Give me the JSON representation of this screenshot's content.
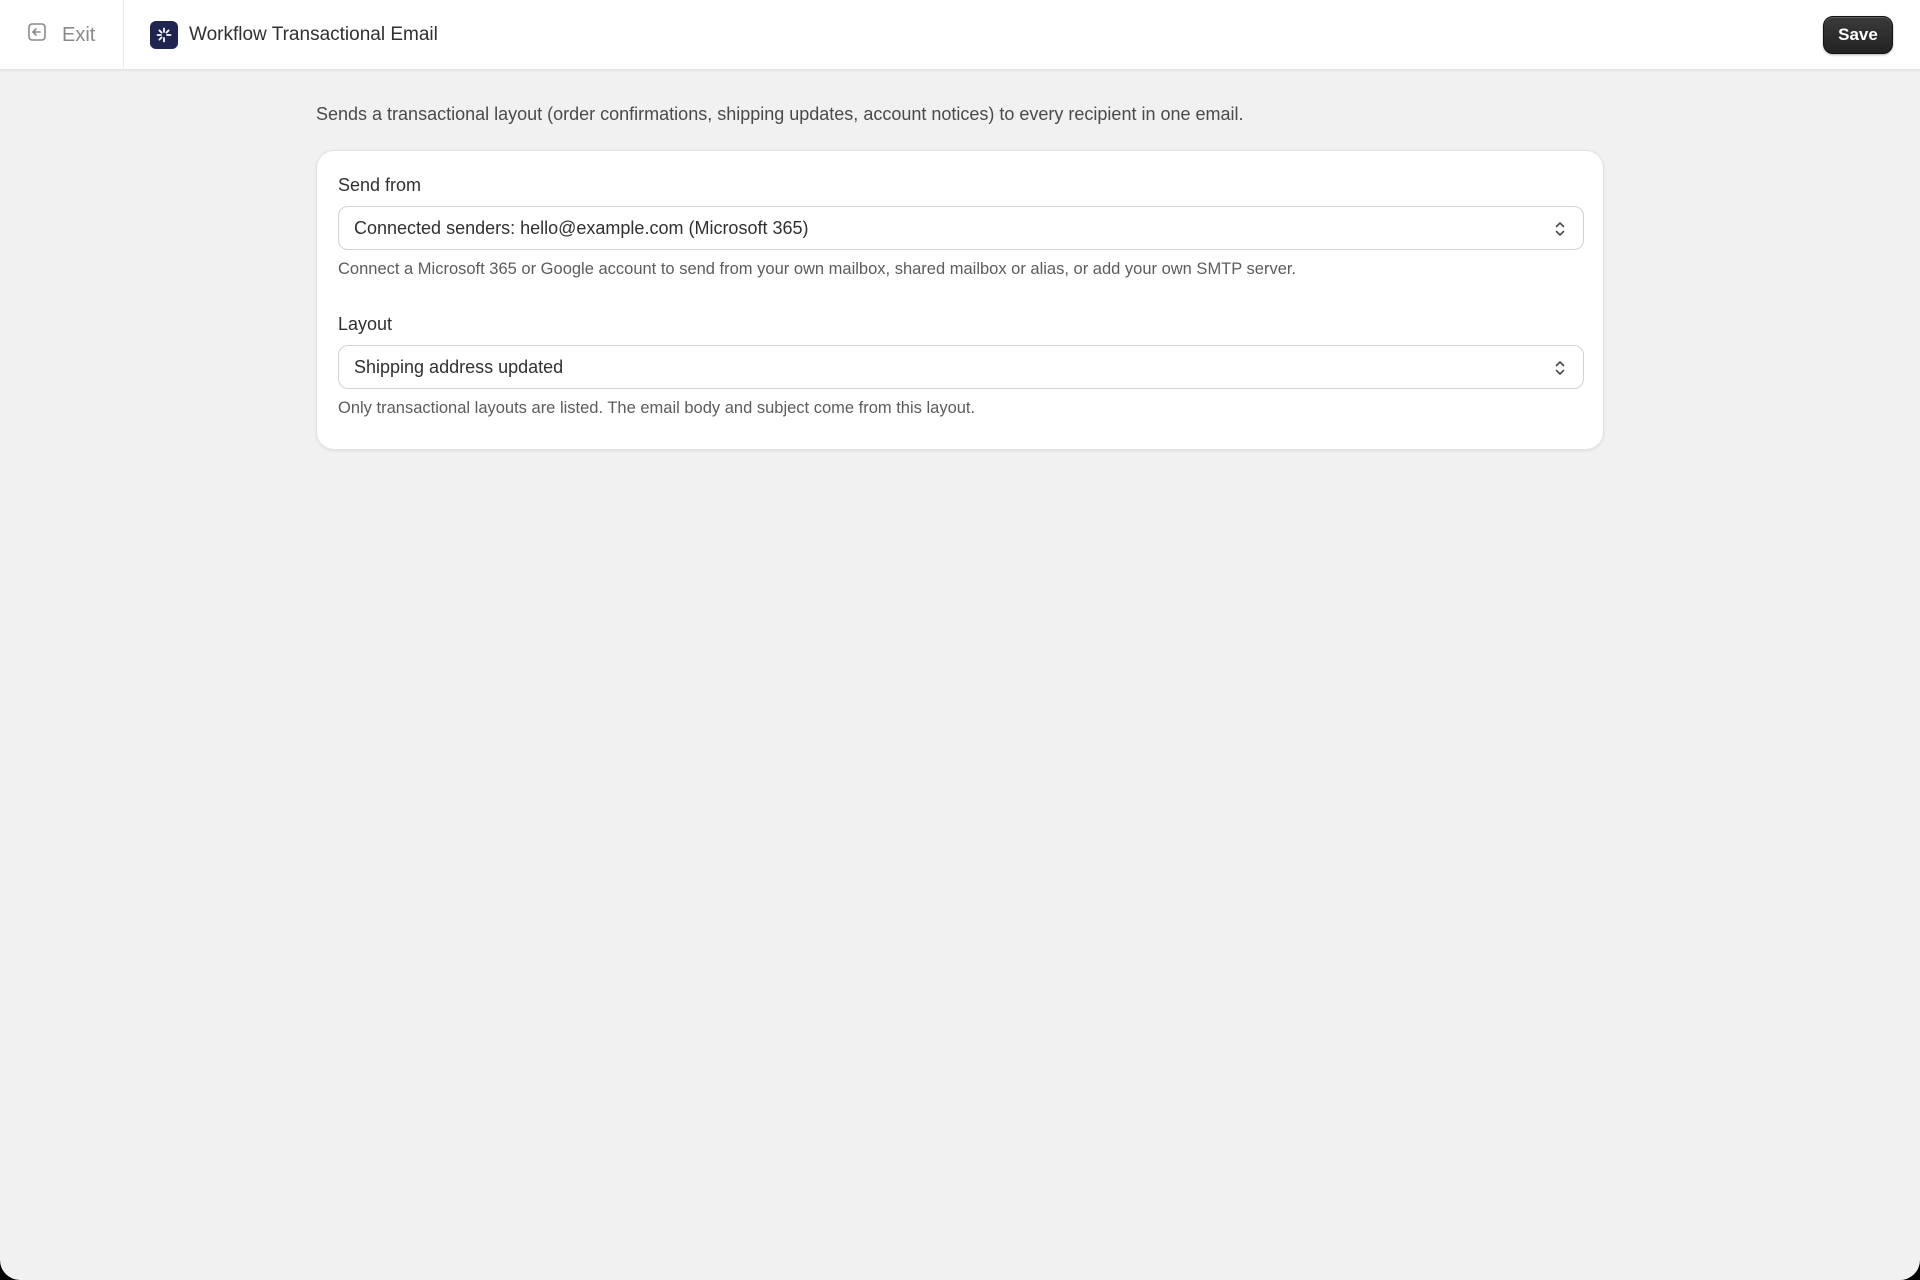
{
  "topbar": {
    "exit_label": "Exit",
    "title": "Workflow Transactional Email",
    "save_label": "Save",
    "app_icon_color": "#1f2451"
  },
  "main": {
    "description": "Sends a transactional layout (order confirmations, shipping updates, account notices) to every recipient in one email.",
    "send_from": {
      "label": "Send from",
      "selected": "Connected senders: hello@example.com (Microsoft 365)",
      "help": "Connect a Microsoft 365 or Google account to send from your own mailbox, shared mailbox or alias, or add your own SMTP server."
    },
    "layout": {
      "label": "Layout",
      "selected": "Shipping address updated",
      "help": "Only transactional layouts are listed. The email body and subject come from this layout."
    }
  }
}
